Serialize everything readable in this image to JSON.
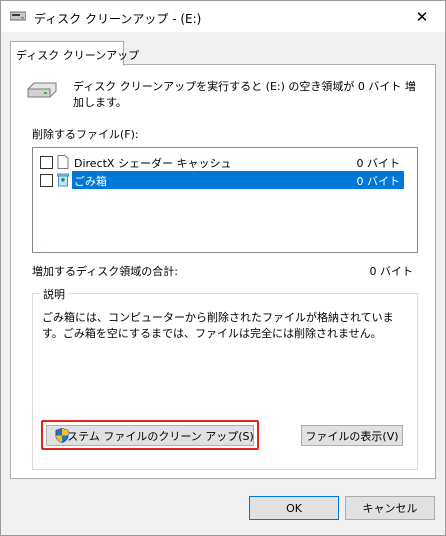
{
  "window": {
    "title": "ディスク クリーンアップ - (E:)",
    "icon": "disk-cleanup-icon",
    "close_glyph": "✕"
  },
  "tab": {
    "label": "ディスク クリーンアップ"
  },
  "summary": {
    "text": "ディスク クリーンアップを実行すると (E:) の空き領域が 0 バイト 増加します。"
  },
  "files": {
    "label": "削除するファイル(F):",
    "items": [
      {
        "name": "DirectX シェーダー キャッシュ",
        "size": "0 バイト",
        "checked": false,
        "selected": false,
        "icon": "file-icon"
      },
      {
        "name": "ごみ箱",
        "size": "0 バイト",
        "checked": false,
        "selected": true,
        "icon": "recycle-bin-icon"
      }
    ]
  },
  "total": {
    "label": "増加するディスク領域の合計:",
    "value": "0 バイト"
  },
  "description": {
    "title": "説明",
    "text": "ごみ箱には、コンピューターから削除されたファイルが格納されています。ごみ箱を空にするまでは、ファイルは完全には削除されません。"
  },
  "buttons": {
    "system_cleanup": "システム ファイルのクリーン アップ(S)",
    "view_files": "ファイルの表示(V)",
    "ok": "OK",
    "cancel": "キャンセル"
  },
  "colors": {
    "selection": "#0078d7",
    "highlight_border": "#e3241b"
  }
}
